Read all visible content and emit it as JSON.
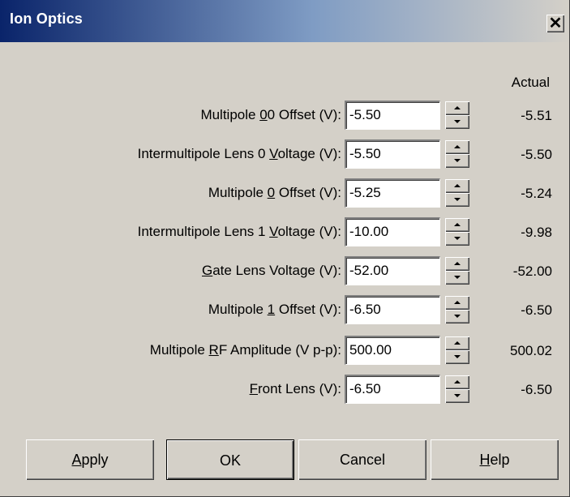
{
  "window": {
    "title": "Ion Optics",
    "close_glyph": "✕"
  },
  "columns": {
    "actual_header": "Actual"
  },
  "rows": [
    {
      "label_pre": "Multipole ",
      "label_key": "0",
      "label_post": "0 Offset (V):",
      "value": "-5.50",
      "actual": "-5.51"
    },
    {
      "label_pre": "Intermultipole Lens 0 ",
      "label_key": "V",
      "label_post": "oltage (V):",
      "value": "-5.50",
      "actual": "-5.50"
    },
    {
      "label_pre": "Multipole ",
      "label_key": "0",
      "label_post": " Offset (V):",
      "value": "-5.25",
      "actual": "-5.24"
    },
    {
      "label_pre": "Intermultipole Lens 1 ",
      "label_key": "V",
      "label_post": "oltage (V):",
      "value": "-10.00",
      "actual": "-9.98"
    },
    {
      "label_pre": "",
      "label_key": "G",
      "label_post": "ate Lens Voltage (V):",
      "value": "-52.00",
      "actual": "-52.00"
    },
    {
      "label_pre": "Multipole ",
      "label_key": "1",
      "label_post": " Offset (V):",
      "value": "-6.50",
      "actual": "-6.50"
    },
    {
      "label_pre": "Multipole ",
      "label_key": "R",
      "label_post": "F Amplitude (V p-p):",
      "value": "500.00",
      "actual": "500.02"
    },
    {
      "label_pre": "",
      "label_key": "F",
      "label_post": "ront Lens (V):",
      "value": "-6.50",
      "actual": "-6.50"
    }
  ],
  "buttons": {
    "apply": {
      "key": "A",
      "rest": "pply"
    },
    "ok": {
      "label": "OK"
    },
    "cancel": {
      "label": "Cancel"
    },
    "help": {
      "key": "H",
      "rest": "elp"
    }
  }
}
